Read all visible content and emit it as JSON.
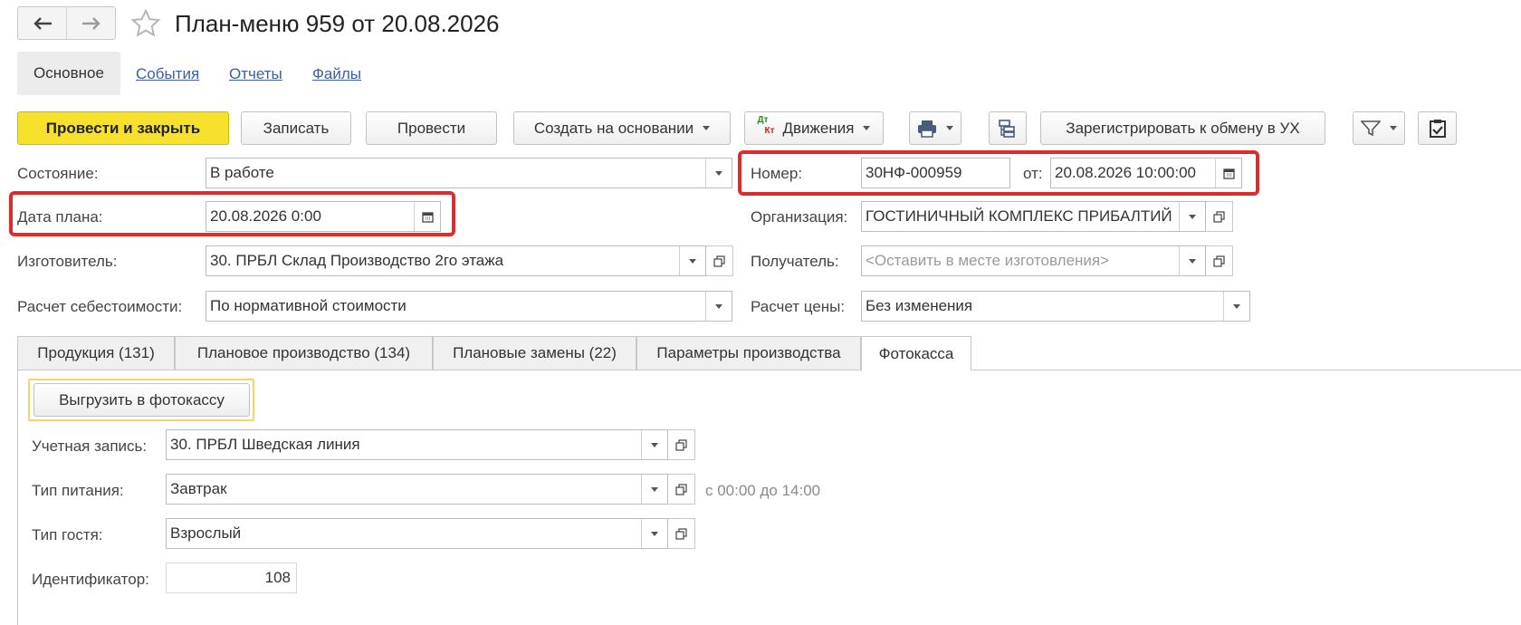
{
  "header": {
    "title": "План-меню 959 от 20.08.2026"
  },
  "sections": {
    "main": "Основное",
    "events": "События",
    "reports": "Отчеты",
    "files": "Файлы"
  },
  "toolbar": {
    "post_close": "Провести и закрыть",
    "save": "Записать",
    "post": "Провести",
    "create_based": "Создать на основании",
    "movements_badge_top": "Дт",
    "movements_badge_bottom": "Кт",
    "movements": "Движения",
    "register_exchange": "Зарегистрировать к обмену в УХ"
  },
  "form": {
    "state_label": "Состояние:",
    "state_value": "В работе",
    "number_label": "Номер:",
    "number_value": "30НФ-000959",
    "from_label": "от:",
    "from_value": "20.08.2026 10:00:00",
    "plan_date_label": "Дата плана:",
    "plan_date_value": "20.08.2026  0:00",
    "org_label": "Организация:",
    "org_value": "ГОСТИНИЧНЫЙ КОМПЛЕКС ПРИБАЛТИЙ",
    "maker_label": "Изготовитель:",
    "maker_value": "30. ПРБЛ Склад Производство 2го этажа",
    "receiver_label": "Получатель:",
    "receiver_placeholder": "<Оставить в месте изготовления>",
    "cost_label": "Расчет себестоимости:",
    "cost_value": "По нормативной стоимости",
    "price_label": "Расчет цены:",
    "price_value": "Без изменения"
  },
  "tabs": [
    {
      "label": "Продукция (131)"
    },
    {
      "label": "Плановое производство (134)"
    },
    {
      "label": "Плановые замены (22)"
    },
    {
      "label": "Параметры производства"
    },
    {
      "label": "Фотокасса"
    }
  ],
  "photokassa": {
    "upload_button": "Выгрузить в фотокассу",
    "account_label": "Учетная запись:",
    "account_value": "30. ПРБЛ Шведская линия",
    "meal_label": "Тип питания:",
    "meal_value": "Завтрак",
    "meal_time": "с 00:00 до 14:00",
    "guest_label": "Тип гостя:",
    "guest_value": "Взрослый",
    "id_label": "Идентификатор:",
    "id_value": "108"
  },
  "colors": {
    "accent_primary": "#f8e12c",
    "highlight": "#e12b2b",
    "link": "#3b5ea8"
  },
  "icons": [
    "back-arrow-icon",
    "forward-arrow-icon",
    "star-icon",
    "printer-icon",
    "structure-icon",
    "filter-icon",
    "checklist-icon",
    "calendar-icon",
    "dropdown-icon",
    "open-icon"
  ]
}
